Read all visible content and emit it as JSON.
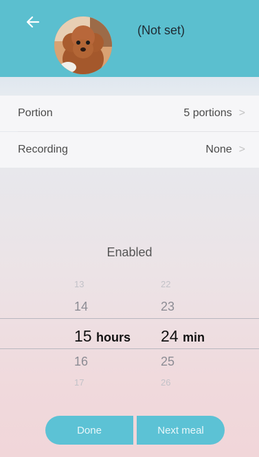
{
  "header": {
    "title": "(Not set)",
    "back_icon": "arrow-left-icon",
    "colors": {
      "header_bg": "#5bbfcf",
      "accent": "#5cc2d5"
    }
  },
  "settings": {
    "portion": {
      "label": "Portion",
      "value": "5 portions"
    },
    "recording": {
      "label": "Recording",
      "value": "None"
    },
    "chevron": ">"
  },
  "picker": {
    "enabled_label": "Enabled",
    "hours": {
      "above2": "13",
      "above1": "14",
      "selected": "15",
      "unit": "hours",
      "below1": "16",
      "below2": "17"
    },
    "minutes": {
      "above2": "22",
      "above1": "23",
      "selected": "24",
      "unit": "min",
      "below1": "25",
      "below2": "26"
    }
  },
  "buttons": {
    "done": "Done",
    "next_meal": "Next meal"
  }
}
